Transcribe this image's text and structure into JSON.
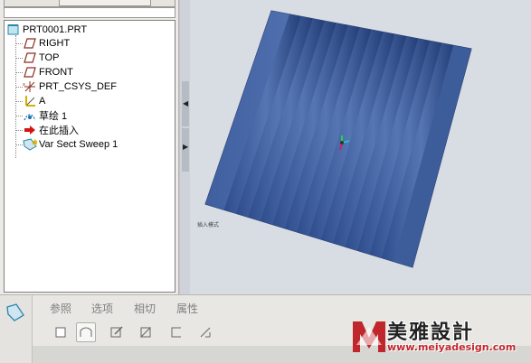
{
  "model_tree": {
    "items": [
      {
        "label": "PRT0001.PRT",
        "icon": "part-icon"
      },
      {
        "label": "RIGHT",
        "icon": "datum-plane-icon"
      },
      {
        "label": "TOP",
        "icon": "datum-plane-icon"
      },
      {
        "label": "FRONT",
        "icon": "datum-plane-icon"
      },
      {
        "label": "PRT_CSYS_DEF",
        "icon": "csys-icon"
      },
      {
        "label": "A",
        "icon": "datum-axis-icon"
      },
      {
        "label": "草绘 1",
        "icon": "sketch-icon"
      },
      {
        "label": "在此插入",
        "icon": "insert-here-arrow-icon"
      },
      {
        "label": "Var Sect Sweep 1",
        "icon": "var-sect-sweep-icon"
      }
    ]
  },
  "viewport": {
    "status_label": "插入模式",
    "model_color": "#3a5a96"
  },
  "dashboard": {
    "tabs": [
      {
        "label": "参照"
      },
      {
        "label": "选项"
      },
      {
        "label": "相切"
      },
      {
        "label": "属性"
      }
    ],
    "tools": [
      "solid-icon",
      "surface-icon",
      "sketch-section-icon",
      "remove-material-icon",
      "thicken-icon",
      "constant-section-icon"
    ]
  },
  "watermark": {
    "title": "美雅設計",
    "url": "www.meiyadesign.com",
    "logo_color": "#c0272d"
  }
}
